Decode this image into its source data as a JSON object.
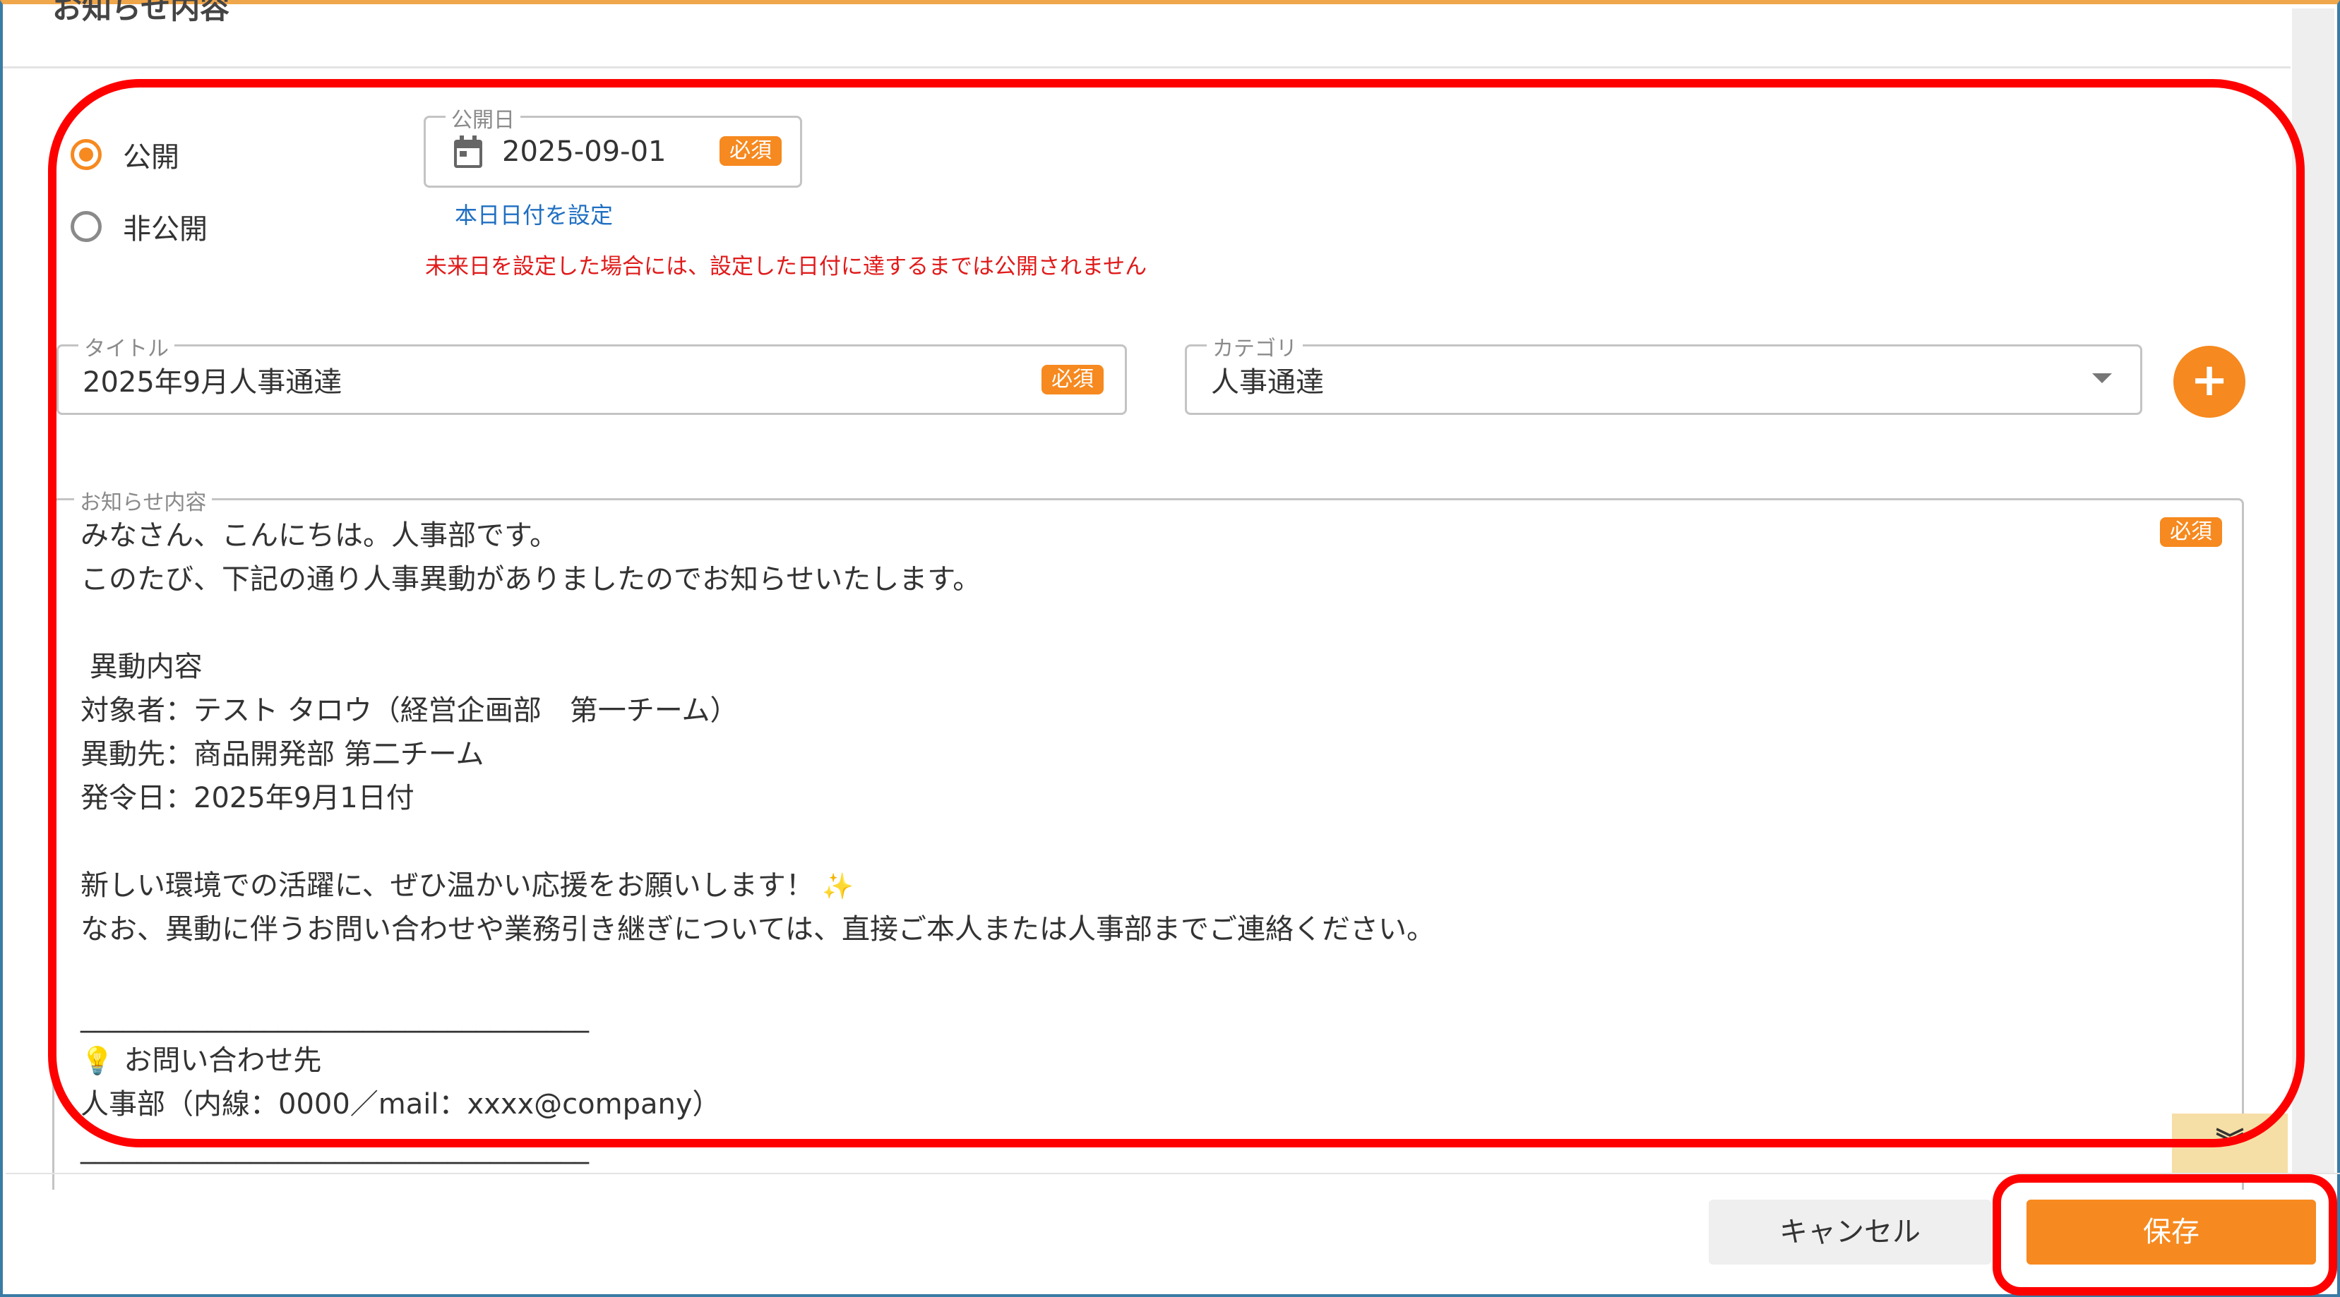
{
  "section_title": "お知らせ内容",
  "visibility": {
    "public_label": "公開",
    "private_label": "非公開",
    "selected": "public"
  },
  "publish_date": {
    "legend": "公開日",
    "value": "2025-09-01",
    "required": "必須",
    "set_today_link": "本日日付を設定",
    "note": "未来日を設定した場合には、設定した日付に達するまでは公開されません"
  },
  "title_field": {
    "legend": "タイトル",
    "value": "2025年9月人事通達",
    "required": "必須"
  },
  "category_field": {
    "legend": "カテゴリ",
    "value": "人事通達",
    "add_button": "+"
  },
  "content_field": {
    "legend": "お知らせ内容",
    "required": "必須",
    "lines": [
      "みなさん、こんにちは。人事部です。",
      "このたび、下記の通り人事異動がありましたのでお知らせいたします。",
      "",
      " 異動内容",
      "対象者：テスト タロウ（経営企画部　第一チーム）",
      "異動先：商品開発部 第二チーム",
      "発令日：2025年9月1日付",
      "",
      "新しい環境での活躍に、ぜひ温かい応援をお願いします！",
      "なお、異動に伴うお問い合わせや業務引き継ぎについては、直接ご本人または人事部までご連絡ください。",
      "",
      "____________________________________",
      "お問い合わせ先",
      "人事部（内線：0000／mail：xxxx@company）",
      "____________________________________"
    ],
    "expand_icon": "double-chevron-down-icon"
  },
  "footer": {
    "cancel_label": "キャンセル",
    "save_label": "保存"
  },
  "colors": {
    "accent": "#f6891f",
    "link": "#1f6fc2",
    "warning": "#e01a1a",
    "annotation": "#ff0000"
  }
}
